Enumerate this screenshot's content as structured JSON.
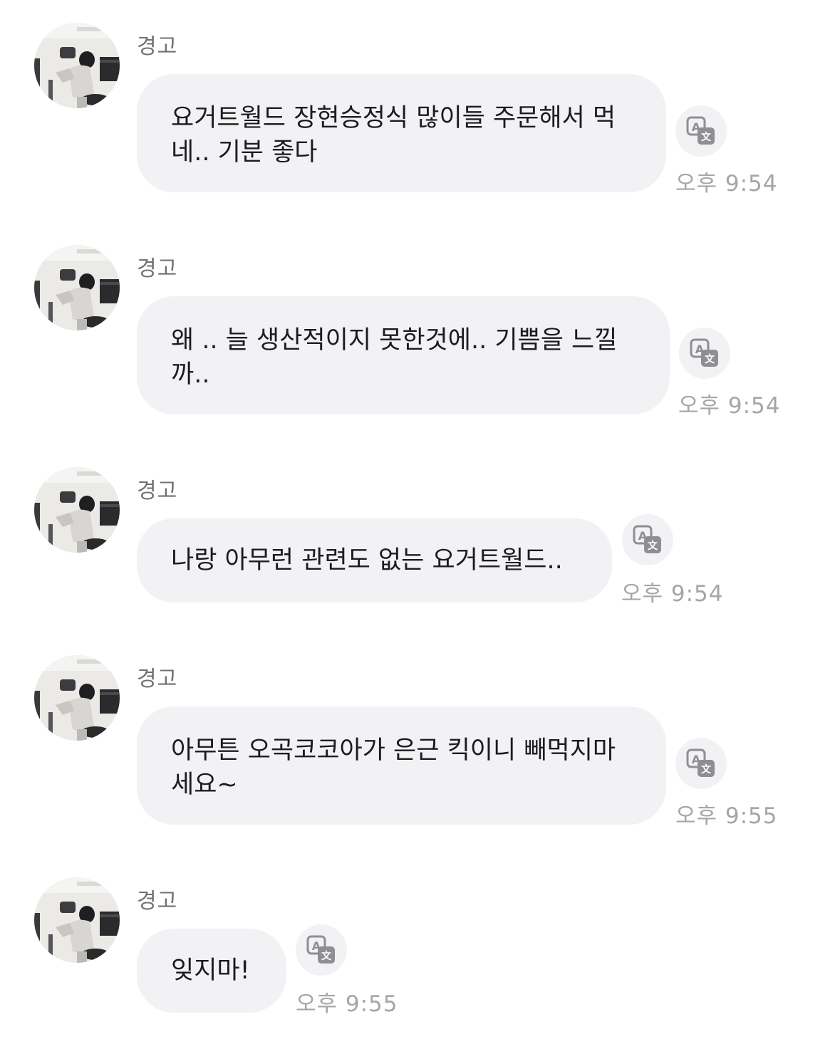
{
  "messages": [
    {
      "sender": "경고",
      "line1": "요거트월드 장현승정식 많이들 주문해서 먹",
      "line2": "네.. 기분 좋다",
      "time": "오후 9:54",
      "translate_icon": "translate-icon"
    },
    {
      "sender": "경고",
      "line1": "왜 .. 늘 생산적이지 못한것에.. 기쁨을 느낄",
      "line2": "까..",
      "time": "오후 9:54",
      "translate_icon": "translate-icon"
    },
    {
      "sender": "경고",
      "line1": "나랑 아무런 관련도 없는 요거트월드..",
      "line2": "",
      "time": "오후 9:54",
      "translate_icon": "translate-icon"
    },
    {
      "sender": "경고",
      "line1": "아무튼 오곡코코아가 은근 킥이니 빼먹지마",
      "line2": "세요~",
      "time": "오후 9:55",
      "translate_icon": "translate-icon"
    },
    {
      "sender": "경고",
      "line1": "잊지마!",
      "line2": "",
      "time": "오후 9:55",
      "translate_icon": "translate-icon"
    }
  ],
  "colors": {
    "background": "#ffffff",
    "bubble": "#f2f2f5",
    "text": "#1c1c1e",
    "sender": "#707075",
    "time": "#a5a5aa",
    "icon": "#8e8e93"
  }
}
